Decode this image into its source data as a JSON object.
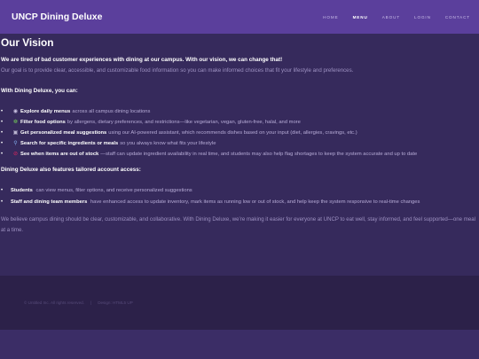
{
  "header": {
    "brand": "UNCP Dining Deluxe",
    "nav": [
      "HOME",
      "MENU",
      "ABOUT",
      "LOGIN",
      "CONTACT"
    ]
  },
  "main": {
    "title": "Our Vision",
    "lead": "We are tired of bad customer experiences with dining at our campus. With our vision, we can change that!",
    "intro": "Our goal is to provide clear, accessible, and customizable food information so you can make informed choices that fit your lifestyle and preferences.",
    "features_heading": "With Dining Deluxe, you can:",
    "features": [
      {
        "icon": "plate-icon",
        "glyph": "◉",
        "bold": "Explore daily menus",
        "text": "across all campus dining locations"
      },
      {
        "icon": "leaf-icon",
        "glyph": "❁",
        "bold": "Filter food options",
        "text": "by allergens, dietary preferences, and restrictions—like vegetarian, vegan, gluten-free, halal, and more"
      },
      {
        "icon": "robot-icon",
        "glyph": "▣",
        "bold": "Get personalized meal suggestions",
        "text": "using our AI-powered assistant, which recommends dishes based on your input (diet, allergies, cravings, etc.)"
      },
      {
        "icon": "magnifier-icon",
        "glyph": "⚲",
        "bold": "Search for specific ingredients or meals",
        "text": "so you always know what fits your lifestyle"
      },
      {
        "icon": "prohibited-icon",
        "glyph": "⊘",
        "bold": "See when items are out of stock",
        "text": "—staff can update ingredient availability in real time, and students may also help flag shortages to keep the system accurate and up to date"
      }
    ],
    "accounts_heading": "Dining Deluxe also features tailored account access:",
    "accounts": [
      {
        "bold": "Students",
        "text": "can view menus, filter options, and receive personalized suggestions"
      },
      {
        "bold": "Staff and dining team members",
        "text": "have enhanced access to update inventory, mark items as running low or out of stock, and help keep the system responsive to real-time changes"
      }
    ],
    "closing": "We believe campus dining should be clear, customizable, and collaborative. With Dining Deluxe, we’re making it easier for everyone at UNCP to eat well, stay informed, and feel supported—one meal at a time."
  },
  "footer": {
    "copyright": "© Untitled Inc. All rights reserved.",
    "separator": "|",
    "design": "Design: HTML5 UP"
  },
  "colors": {
    "header_bg": "#5b3f9c",
    "main_bg": "#362a5c",
    "footer_bg": "#2c2149",
    "accent": "#e0245e"
  }
}
